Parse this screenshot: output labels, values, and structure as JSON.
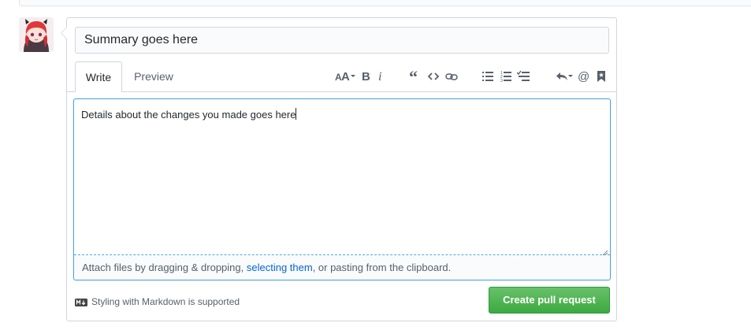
{
  "comment_form": {
    "title_value": "Summary goes here",
    "tabs": [
      {
        "label": "Write",
        "active": true
      },
      {
        "label": "Preview",
        "active": false
      }
    ],
    "toolbar": {
      "icons": [
        "header-icon",
        "bold-icon",
        "italic-icon",
        "quote-icon",
        "code-icon",
        "link-icon",
        "bulleted-list-icon",
        "numbered-list-icon",
        "task-list-icon",
        "reply-icon",
        "mention-icon",
        "saved-reply-icon"
      ]
    },
    "body_value": "Details about the changes you made goes here",
    "attach": {
      "prefix": "Attach files by dragging & dropping, ",
      "link": "selecting them",
      "suffix": ", or pasting from the clipboard."
    },
    "markdown_note": "Styling with Markdown is supported",
    "submit_label": "Create pull request"
  },
  "colors": {
    "accent_blue": "#0366d6",
    "focus_border": "#4aa6e0",
    "green_button": "#3caa3f",
    "text_muted": "#586069",
    "border": "#d1d5da"
  }
}
